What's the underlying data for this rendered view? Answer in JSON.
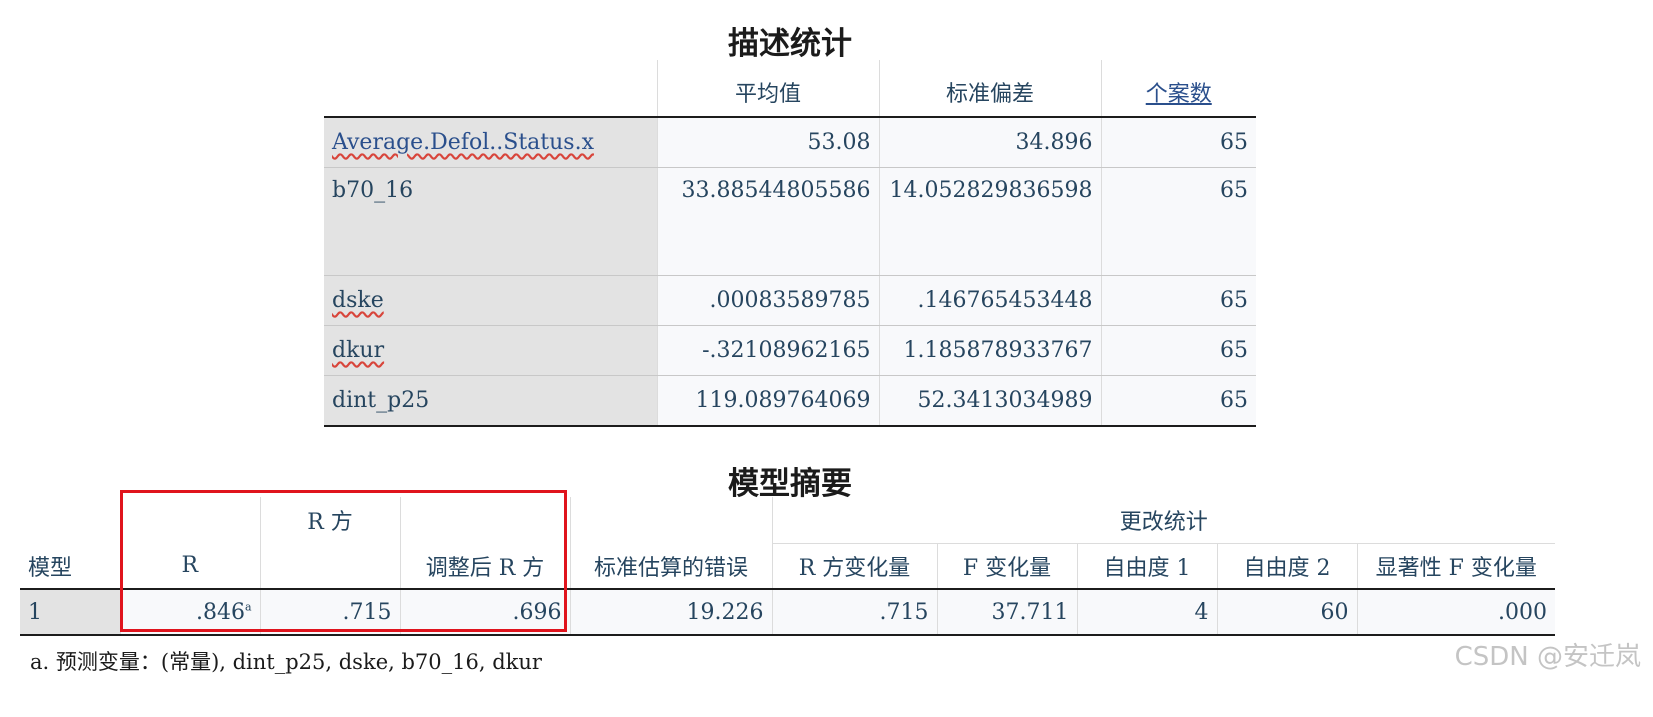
{
  "descriptive": {
    "title": "描述统计",
    "headers": [
      "平均值",
      "标准偏差",
      "个案数"
    ],
    "rows": [
      {
        "label": "Average.Defol..Status.x",
        "mean": "53.08",
        "sd": "34.896",
        "n": "65"
      },
      {
        "label": "b70_16",
        "mean": "33.88544805586",
        "sd": "14.052829836598",
        "n": "65"
      },
      {
        "label": "dske",
        "mean": ".00083589785",
        "sd": ".146765453448",
        "n": "65"
      },
      {
        "label": "dkur",
        "mean": "-.32108962165",
        "sd": "1.185878933767",
        "n": "65"
      },
      {
        "label": "dint_p25",
        "mean": "119.089764069",
        "sd": "52.3413034989",
        "n": "65"
      }
    ]
  },
  "model_summary": {
    "title": "模型摘要",
    "group_header": "更改统计",
    "headers": {
      "model": "模型",
      "r": "R",
      "r2": "R 方",
      "adj_r2": "调整后 R 方",
      "se": "标准估算的错误",
      "r2_change": "R 方变化量",
      "f_change": "F 变化量",
      "df1": "自由度 1",
      "df2": "自由度 2",
      "sig_f": "显著性 F 变化量"
    },
    "row": {
      "model": "1",
      "r": ".846",
      "r_sup": "a",
      "r2": ".715",
      "adj_r2": ".696",
      "se": "19.226",
      "r2_change": ".715",
      "f_change": "37.711",
      "df1": "4",
      "df2": "60",
      "sig_f": ".000"
    },
    "footnote": "a. 预测变量：(常量), dint_p25, dske, b70_16, dkur"
  },
  "watermark": "CSDN @安迁岚",
  "colors": {
    "highlight_box": "#e0141d"
  }
}
